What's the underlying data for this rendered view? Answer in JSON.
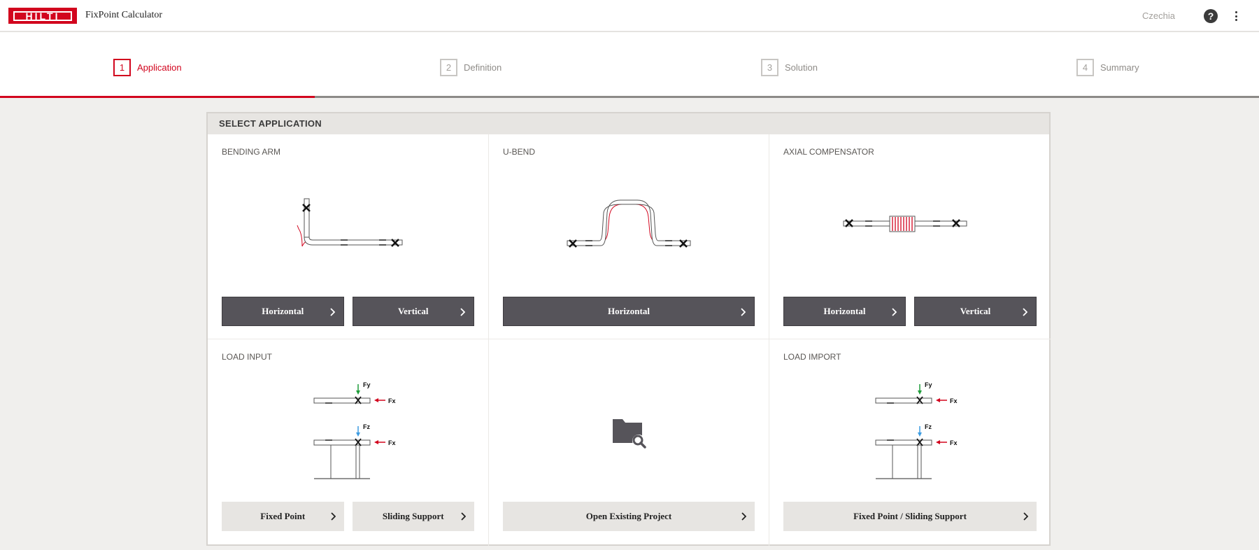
{
  "header": {
    "logo_text": "HILTI",
    "app_title": "FixPoint Calculator",
    "country": "Czechia"
  },
  "steps": [
    {
      "number": "1",
      "label": "Application",
      "active": true
    },
    {
      "number": "2",
      "label": "Definition",
      "active": false
    },
    {
      "number": "3",
      "label": "Solution",
      "active": false
    },
    {
      "number": "4",
      "label": "Summary",
      "active": false
    }
  ],
  "progress": {
    "completed_steps": 1,
    "total_steps": 4
  },
  "panel": {
    "title": "SELECT APPLICATION",
    "cards": {
      "bending_arm": {
        "title": "BENDING ARM",
        "buttons": [
          "Horizontal",
          "Vertical"
        ]
      },
      "u_bend": {
        "title": "U-BEND",
        "buttons": [
          "Horizontal"
        ]
      },
      "axial": {
        "title": "AXIAL COMPENSATOR",
        "buttons": [
          "Horizontal",
          "Vertical"
        ]
      },
      "load_input": {
        "title": "LOAD INPUT",
        "buttons": [
          "Fixed Point",
          "Sliding Support"
        ]
      },
      "open_project": {
        "title": "",
        "buttons": [
          "Open Existing Project"
        ]
      },
      "load_import": {
        "title": "LOAD IMPORT",
        "buttons": [
          "Fixed Point / Sliding Support"
        ]
      }
    },
    "force_labels": {
      "fy": "Fy",
      "fx": "Fx",
      "fz": "Fz"
    }
  },
  "colors": {
    "brand_red": "#d2051e",
    "dark_button": "#56545a",
    "light_button": "#e7e5e2",
    "force_green": "#1f9c3a",
    "force_blue": "#3c9be0",
    "force_red": "#d2051e"
  },
  "icons": [
    "help-icon",
    "more-vert-icon",
    "chevron-right-icon",
    "folder-search-icon"
  ]
}
